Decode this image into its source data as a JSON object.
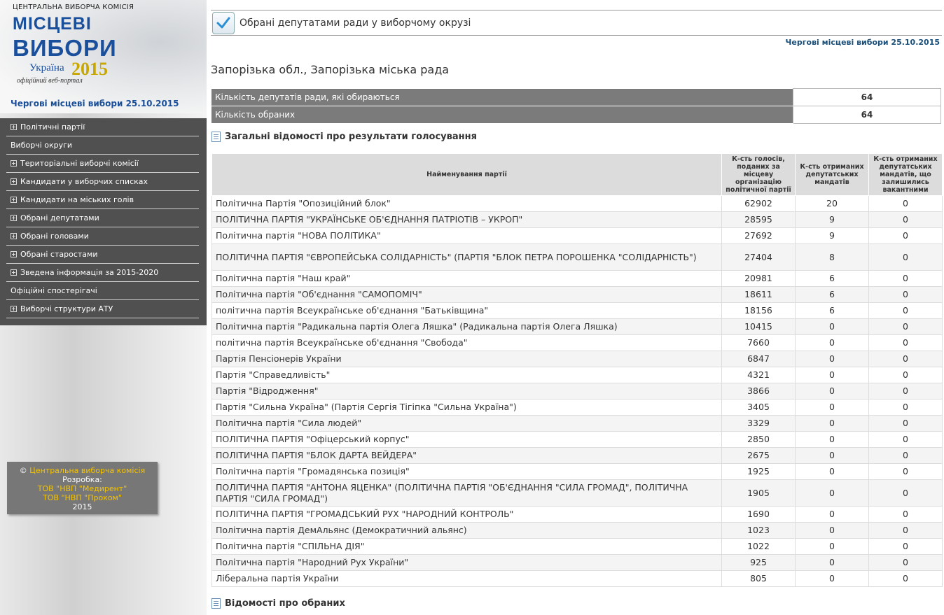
{
  "banner": {
    "cvk": "ЦЕНТРАЛЬНА ВИБОРЧА КОМІСІЯ",
    "title_line1": "МІСЦЕВІ",
    "title_line2": "ВИБОРИ",
    "country": "Україна",
    "year": "2015",
    "portal": "офіційний веб-портал",
    "election_date": "Чергові місцеві вибори 25.10.2015"
  },
  "colors": {
    "menu_bg": "#505050",
    "accent_blue": "#1a4f9c",
    "gold": "#f5c400",
    "table_header": "#dcdcdc",
    "summary_key_bg": "#7b7b7b"
  },
  "menu": [
    {
      "label": "Політичні партії",
      "expandable": true
    },
    {
      "label": "Виборчі округи",
      "expandable": false
    },
    {
      "label": "Територіальні виборчі комісії",
      "expandable": true
    },
    {
      "label": "Кандидати у виборчих списках",
      "expandable": true
    },
    {
      "label": "Кандидати на міських голів",
      "expandable": true
    },
    {
      "label": "Обрані депутатами",
      "expandable": true
    },
    {
      "label": "Обрані головами",
      "expandable": true
    },
    {
      "label": "Обрані старостами",
      "expandable": true
    },
    {
      "label": "Зведена інформація за 2015-2020",
      "expandable": true
    },
    {
      "label": "Офіційні спостерігачі",
      "expandable": false
    },
    {
      "label": "Виборчі структури АТУ",
      "expandable": true
    }
  ],
  "footer": {
    "copyright": "©",
    "cvk": "Центральна виборча комісія",
    "dev_label": "Розробка:",
    "dev1": "ТОВ \"НВП \"Медирент\"",
    "dev2": "ТОВ \"НВП \"Проком\"",
    "year": "2015"
  },
  "page": {
    "title": "Обрані депутатами ради у виборчому окрузі",
    "election": "Чергові місцеві вибори 25.10.2015",
    "region": "Запорізька обл., Запорізька міська рада"
  },
  "summary": {
    "seats_label": "Кількість депутатів ради, які обираються",
    "seats_value": "64",
    "elected_label": "Кількість обраних",
    "elected_value": "64"
  },
  "results": {
    "section_title": "Загальні відомості про результати голосування",
    "headers": {
      "party": "Найменування партії",
      "votes": "К-сть голосів, поданих за місцеву організацію політичної партії",
      "mandates": "К-сть отриманих депутатських мандатів",
      "vacant": "К-сть отриманих депутатських мандатів, що залишились вакантними"
    },
    "rows": [
      {
        "party": "Політична Партія \"Опозиційний блок\"",
        "votes": "62902",
        "mandates": "20",
        "vacant": "0"
      },
      {
        "party": "ПОЛІТИЧНА ПАРТІЯ \"УКРАЇНСЬКЕ ОБ'ЄДНАННЯ ПАТРІОТІВ – УКРОП\"",
        "votes": "28595",
        "mandates": "9",
        "vacant": "0"
      },
      {
        "party": "Політична партія \"НОВА ПОЛІТИКА\"",
        "votes": "27692",
        "mandates": "9",
        "vacant": "0"
      },
      {
        "party": "ПОЛІТИЧНА ПАРТІЯ \"ЄВРОПЕЙСЬКА СОЛІДАРНІСТЬ\" (ПАРТІЯ \"БЛОК ПЕТРА ПОРОШЕНКА \"СОЛІДАРНІСТЬ\")",
        "votes": "27404",
        "mandates": "8",
        "vacant": "0",
        "tall": true
      },
      {
        "party": "Політична партія \"Наш край\"",
        "votes": "20981",
        "mandates": "6",
        "vacant": "0"
      },
      {
        "party": "Політична партія \"Об'єднання \"САМОПОМІЧ\"",
        "votes": "18611",
        "mandates": "6",
        "vacant": "0"
      },
      {
        "party": "політична партія Всеукраїнське об'єднання \"Батьківщина\"",
        "votes": "18156",
        "mandates": "6",
        "vacant": "0"
      },
      {
        "party": "Політична партія \"Радикальна партія Олега Ляшка\" (Радикальна партія Олега Ляшка)",
        "votes": "10415",
        "mandates": "0",
        "vacant": "0"
      },
      {
        "party": "політична партія Всеукраїнське об'єднання \"Свобода\"",
        "votes": "7660",
        "mandates": "0",
        "vacant": "0"
      },
      {
        "party": "Партія Пенсіонерів України",
        "votes": "6847",
        "mandates": "0",
        "vacant": "0"
      },
      {
        "party": "Партія \"Справедливість\"",
        "votes": "4321",
        "mandates": "0",
        "vacant": "0"
      },
      {
        "party": "Партія \"Відродження\"",
        "votes": "3866",
        "mandates": "0",
        "vacant": "0"
      },
      {
        "party": "Партія \"Сильна Україна\" (Партія Сергія Тігіпка \"Сильна Україна\")",
        "votes": "3405",
        "mandates": "0",
        "vacant": "0"
      },
      {
        "party": "Політична партія \"Сила людей\"",
        "votes": "3329",
        "mandates": "0",
        "vacant": "0"
      },
      {
        "party": "ПОЛІТИЧНА ПАРТІЯ \"Офіцерський корпус\"",
        "votes": "2850",
        "mandates": "0",
        "vacant": "0"
      },
      {
        "party": "ПОЛІТИЧНА ПАРТІЯ \"БЛОК ДАРТА ВЕЙДЕРА\"",
        "votes": "2675",
        "mandates": "0",
        "vacant": "0"
      },
      {
        "party": "Політична партія \"Громадянська позиція\"",
        "votes": "1925",
        "mandates": "0",
        "vacant": "0"
      },
      {
        "party": "ПОЛІТИЧНА ПАРТІЯ \"АНТОНА ЯЦЕНКА\" (ПОЛІТИЧНА ПАРТІЯ \"ОБ'ЄДНАННЯ \"СИЛА ГРОМАД\", ПОЛІТИЧНА ПАРТІЯ \"СИЛА ГРОМАД\")",
        "votes": "1905",
        "mandates": "0",
        "vacant": "0",
        "tall": true
      },
      {
        "party": "ПОЛІТИЧНА ПАРТІЯ \"ГРОМАДСЬКИЙ РУХ \"НАРОДНИЙ КОНТРОЛЬ\"",
        "votes": "1690",
        "mandates": "0",
        "vacant": "0"
      },
      {
        "party": "Політична партія ДемАльянс (Демократичний альянс)",
        "votes": "1023",
        "mandates": "0",
        "vacant": "0"
      },
      {
        "party": "Політична партія \"СПІЛЬНА ДІЯ\"",
        "votes": "1022",
        "mandates": "0",
        "vacant": "0"
      },
      {
        "party": "Політична партія \"Народний Рух України\"",
        "votes": "925",
        "mandates": "0",
        "vacant": "0"
      },
      {
        "party": "Ліберальна партія України",
        "votes": "805",
        "mandates": "0",
        "vacant": "0"
      }
    ]
  },
  "elected": {
    "section_title": "Відомості про обраних"
  }
}
